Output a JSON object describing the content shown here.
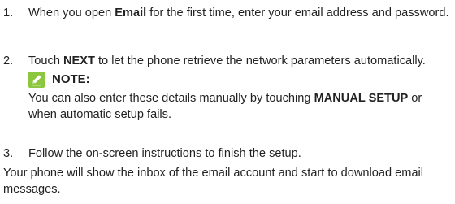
{
  "steps": [
    {
      "num": "1.",
      "pre": "When you open ",
      "bold": "Email",
      "post": " for the first time, enter your email address and password."
    },
    {
      "num": "2.",
      "pre": "Touch ",
      "bold": "NEXT",
      "post": " to let the phone retrieve the network parameters automatically."
    },
    {
      "num": "3.",
      "text": "Follow the on-screen instructions to finish the setup."
    }
  ],
  "note": {
    "icon": "note-pencil-icon",
    "title": "NOTE:",
    "body_pre": "You can also enter these details manually by touching ",
    "body_bold": "MANUAL SETUP",
    "body_post": " or when automatic setup fails."
  },
  "trailing_paragraph": "Your phone will show the inbox of the email account and start to download email messages.",
  "colors": {
    "text": "#222222",
    "icon_bg": "#8dc63f",
    "icon_fg": "#ffffff"
  }
}
